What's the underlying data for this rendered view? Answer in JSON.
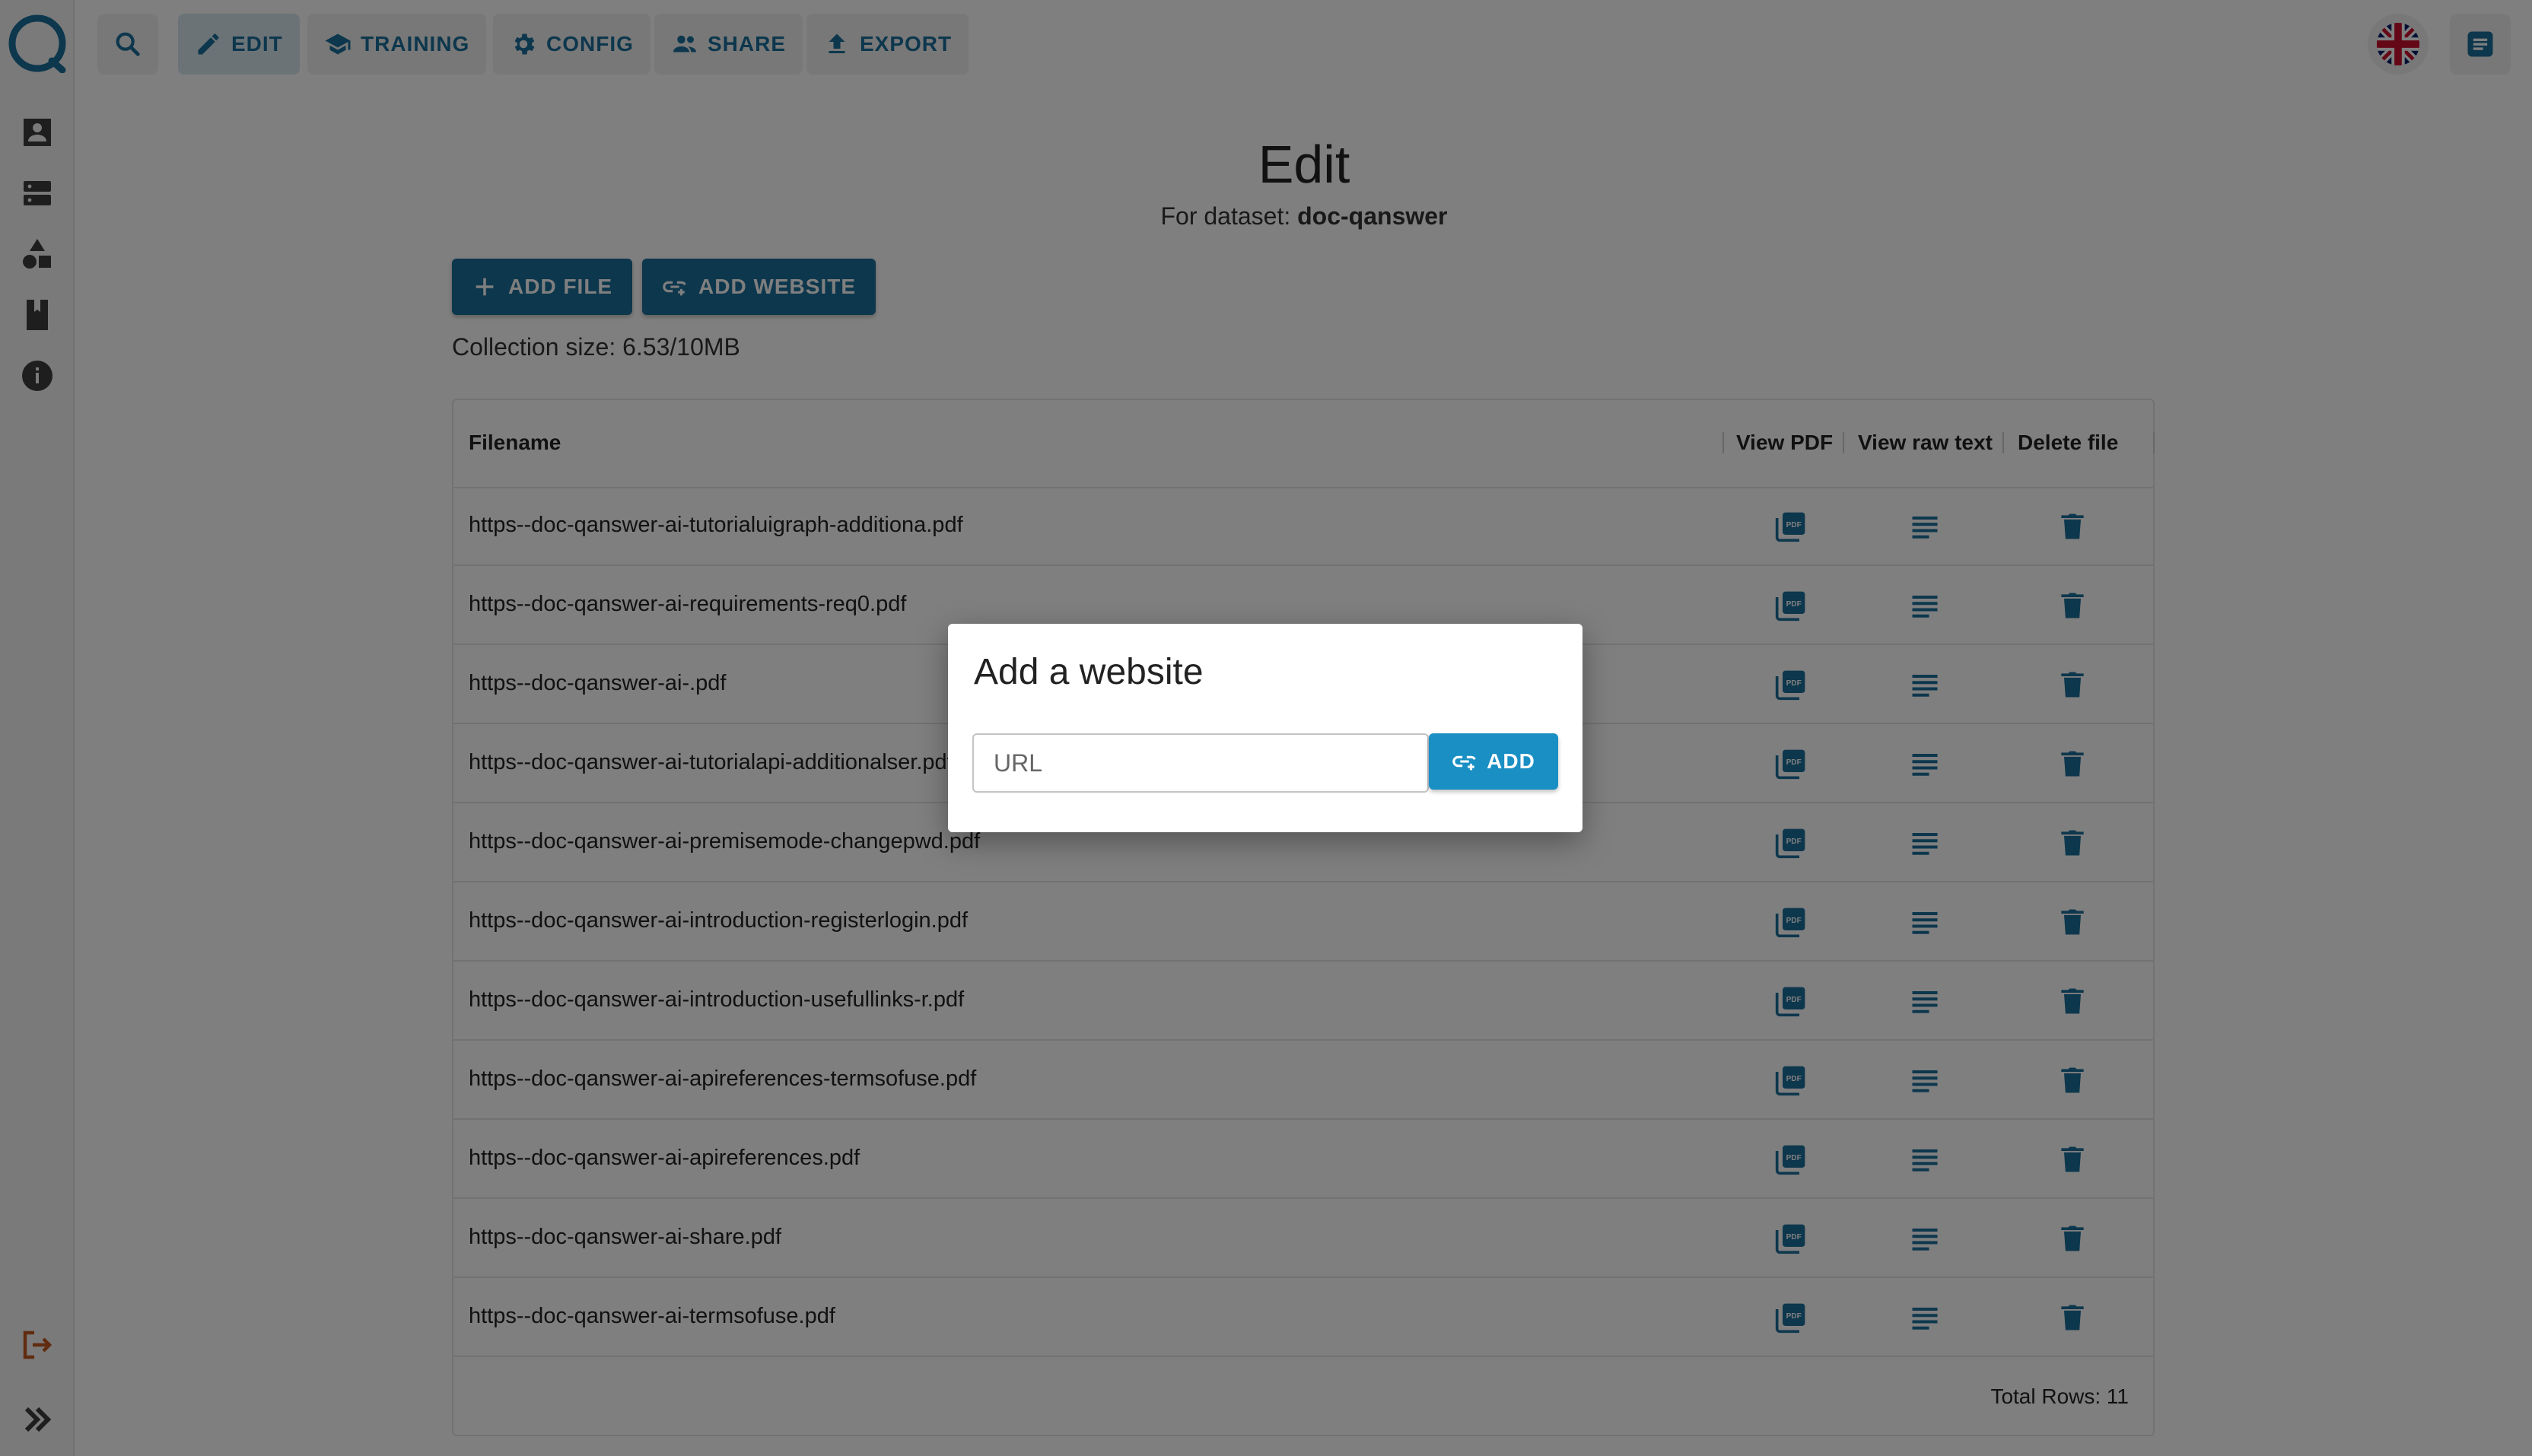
{
  "colors": {
    "primary": "#1a6f9b",
    "dialog_button": "#1a8fc4",
    "logout": "#c0571f",
    "overlay": "rgba(0,0,0,0.5)"
  },
  "sidebar": {
    "items": [
      {
        "name": "account-icon"
      },
      {
        "name": "dataset-icon"
      },
      {
        "name": "shapes-icon"
      },
      {
        "name": "book-icon"
      },
      {
        "name": "info-icon"
      }
    ],
    "logout": "logout-icon",
    "expand": "chevron-double-right-icon"
  },
  "nav": {
    "search_icon": "search-icon",
    "edit": "EDIT",
    "training": "TRAINING",
    "config": "CONFIG",
    "share": "SHARE",
    "export": "EXPORT",
    "language_icon": "uk-flag-icon",
    "docs_icon": "document-icon"
  },
  "page": {
    "title": "Edit",
    "subtitle_prefix": "For dataset: ",
    "dataset": "doc-qanswer"
  },
  "actions": {
    "add_file": "ADD FILE",
    "add_website": "ADD WEBSITE"
  },
  "collection_size": "Collection size: 6.53/10MB",
  "table": {
    "headers": {
      "filename": "Filename",
      "view_pdf": "View PDF",
      "view_raw": "View raw text",
      "delete": "Delete file"
    },
    "rows": [
      "https--doc-qanswer-ai-tutorialuigraph-additiona.pdf",
      "https--doc-qanswer-ai-requirements-req0.pdf",
      "https--doc-qanswer-ai-.pdf",
      "https--doc-qanswer-ai-tutorialapi-additionalser.pdf",
      "https--doc-qanswer-ai-premisemode-changepwd.pdf",
      "https--doc-qanswer-ai-introduction-registerlogin.pdf",
      "https--doc-qanswer-ai-introduction-usefullinks-r.pdf",
      "https--doc-qanswer-ai-apireferences-termsofuse.pdf",
      "https--doc-qanswer-ai-apireferences.pdf",
      "https--doc-qanswer-ai-share.pdf",
      "https--doc-qanswer-ai-termsofuse.pdf"
    ],
    "footer": "Total Rows: 11"
  },
  "dialog": {
    "title": "Add a website",
    "url_placeholder": "URL",
    "url_value": "",
    "add_label": "ADD"
  }
}
